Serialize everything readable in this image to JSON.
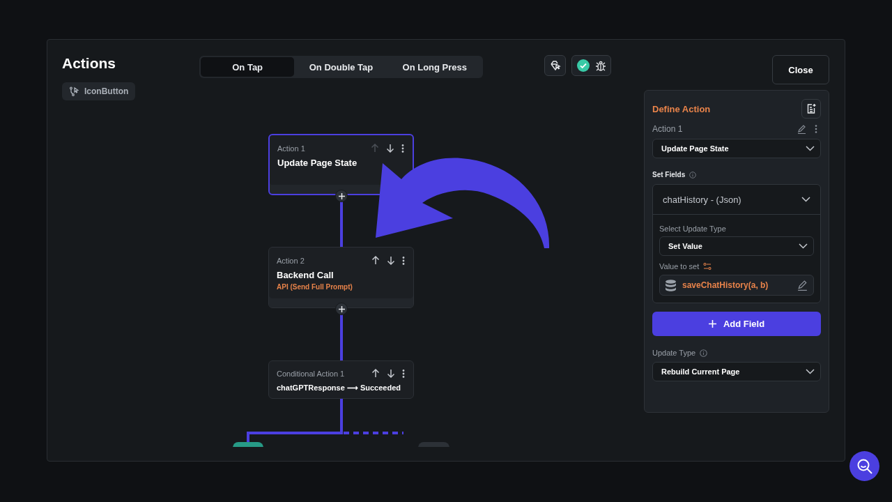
{
  "title": "Actions",
  "widget_chip": {
    "label": "IconButton"
  },
  "trigger_tabs": [
    {
      "label": "On Tap",
      "selected": true
    },
    {
      "label": "On Double Tap",
      "selected": false
    },
    {
      "label": "On Long Press",
      "selected": false
    }
  ],
  "validation": {
    "passed": true
  },
  "close_button": "Close",
  "flow_nodes": [
    {
      "kind": "action",
      "label": "Action 1",
      "title": "Update Page State",
      "selected": true,
      "can_move_up": false
    },
    {
      "kind": "action",
      "label": "Action 2",
      "title": "Backend Call",
      "subtitle": "API (Send Full Prompt)",
      "selected": false,
      "can_move_up": true
    },
    {
      "kind": "conditional",
      "label": "Conditional Action 1",
      "title": "chatGPTResponse ⟶ Succeeded",
      "selected": false,
      "can_move_up": true
    }
  ],
  "panel": {
    "title": "Define Action",
    "action_label": "Action 1",
    "action_type": "Update Page State",
    "set_fields_label": "Set Fields",
    "field": {
      "name": "chatHistory - (Json)",
      "expanded": true,
      "update_type_label": "Select Update Type",
      "update_type": "Set Value",
      "value_label": "Value to set",
      "value": "saveChatHistory(a, b)"
    },
    "add_field_button": "Add Field",
    "update_type_label": "Update Type",
    "update_type": "Rebuild Current Page"
  }
}
